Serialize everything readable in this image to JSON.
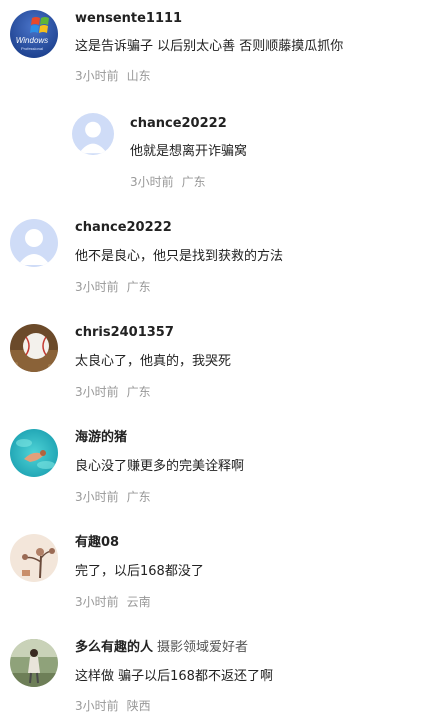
{
  "comments": [
    {
      "avatar": "windows-logo-avatar",
      "username": "wensente1111",
      "text": "这是告诉骗子 以后别太心善 否则顺藤摸瓜抓你",
      "time": "3小时前",
      "location": "山东"
    },
    {
      "avatar": "default-user-avatar",
      "username": "chance20222",
      "text": "他就是想离开诈骗窝",
      "time": "3小时前",
      "location": "广东",
      "is_reply": true
    },
    {
      "avatar": "default-user-avatar",
      "username": "chance20222",
      "text": "他不是良心，他只是找到获救的方法",
      "time": "3小时前",
      "location": "广东"
    },
    {
      "avatar": "baseball-avatar",
      "username": "chris2401357",
      "text": "太良心了，他真的，我哭死",
      "time": "3小时前",
      "location": "广东"
    },
    {
      "avatar": "ocean-swimmer-avatar",
      "username": "海游的猪",
      "text": "良心没了赚更多的完美诠释啊",
      "time": "3小时前",
      "location": "广东"
    },
    {
      "avatar": "tree-illustration-avatar",
      "username": "有趣08",
      "text": "完了，以后168都没了",
      "time": "3小时前",
      "location": "云南"
    },
    {
      "avatar": "person-outdoor-avatar",
      "username": "多么有趣的人",
      "user_tag": "摄影领域爱好者",
      "text": "这样做 骗子以后168都不返还了啊",
      "time": "3小时前",
      "location": "陕西"
    }
  ]
}
